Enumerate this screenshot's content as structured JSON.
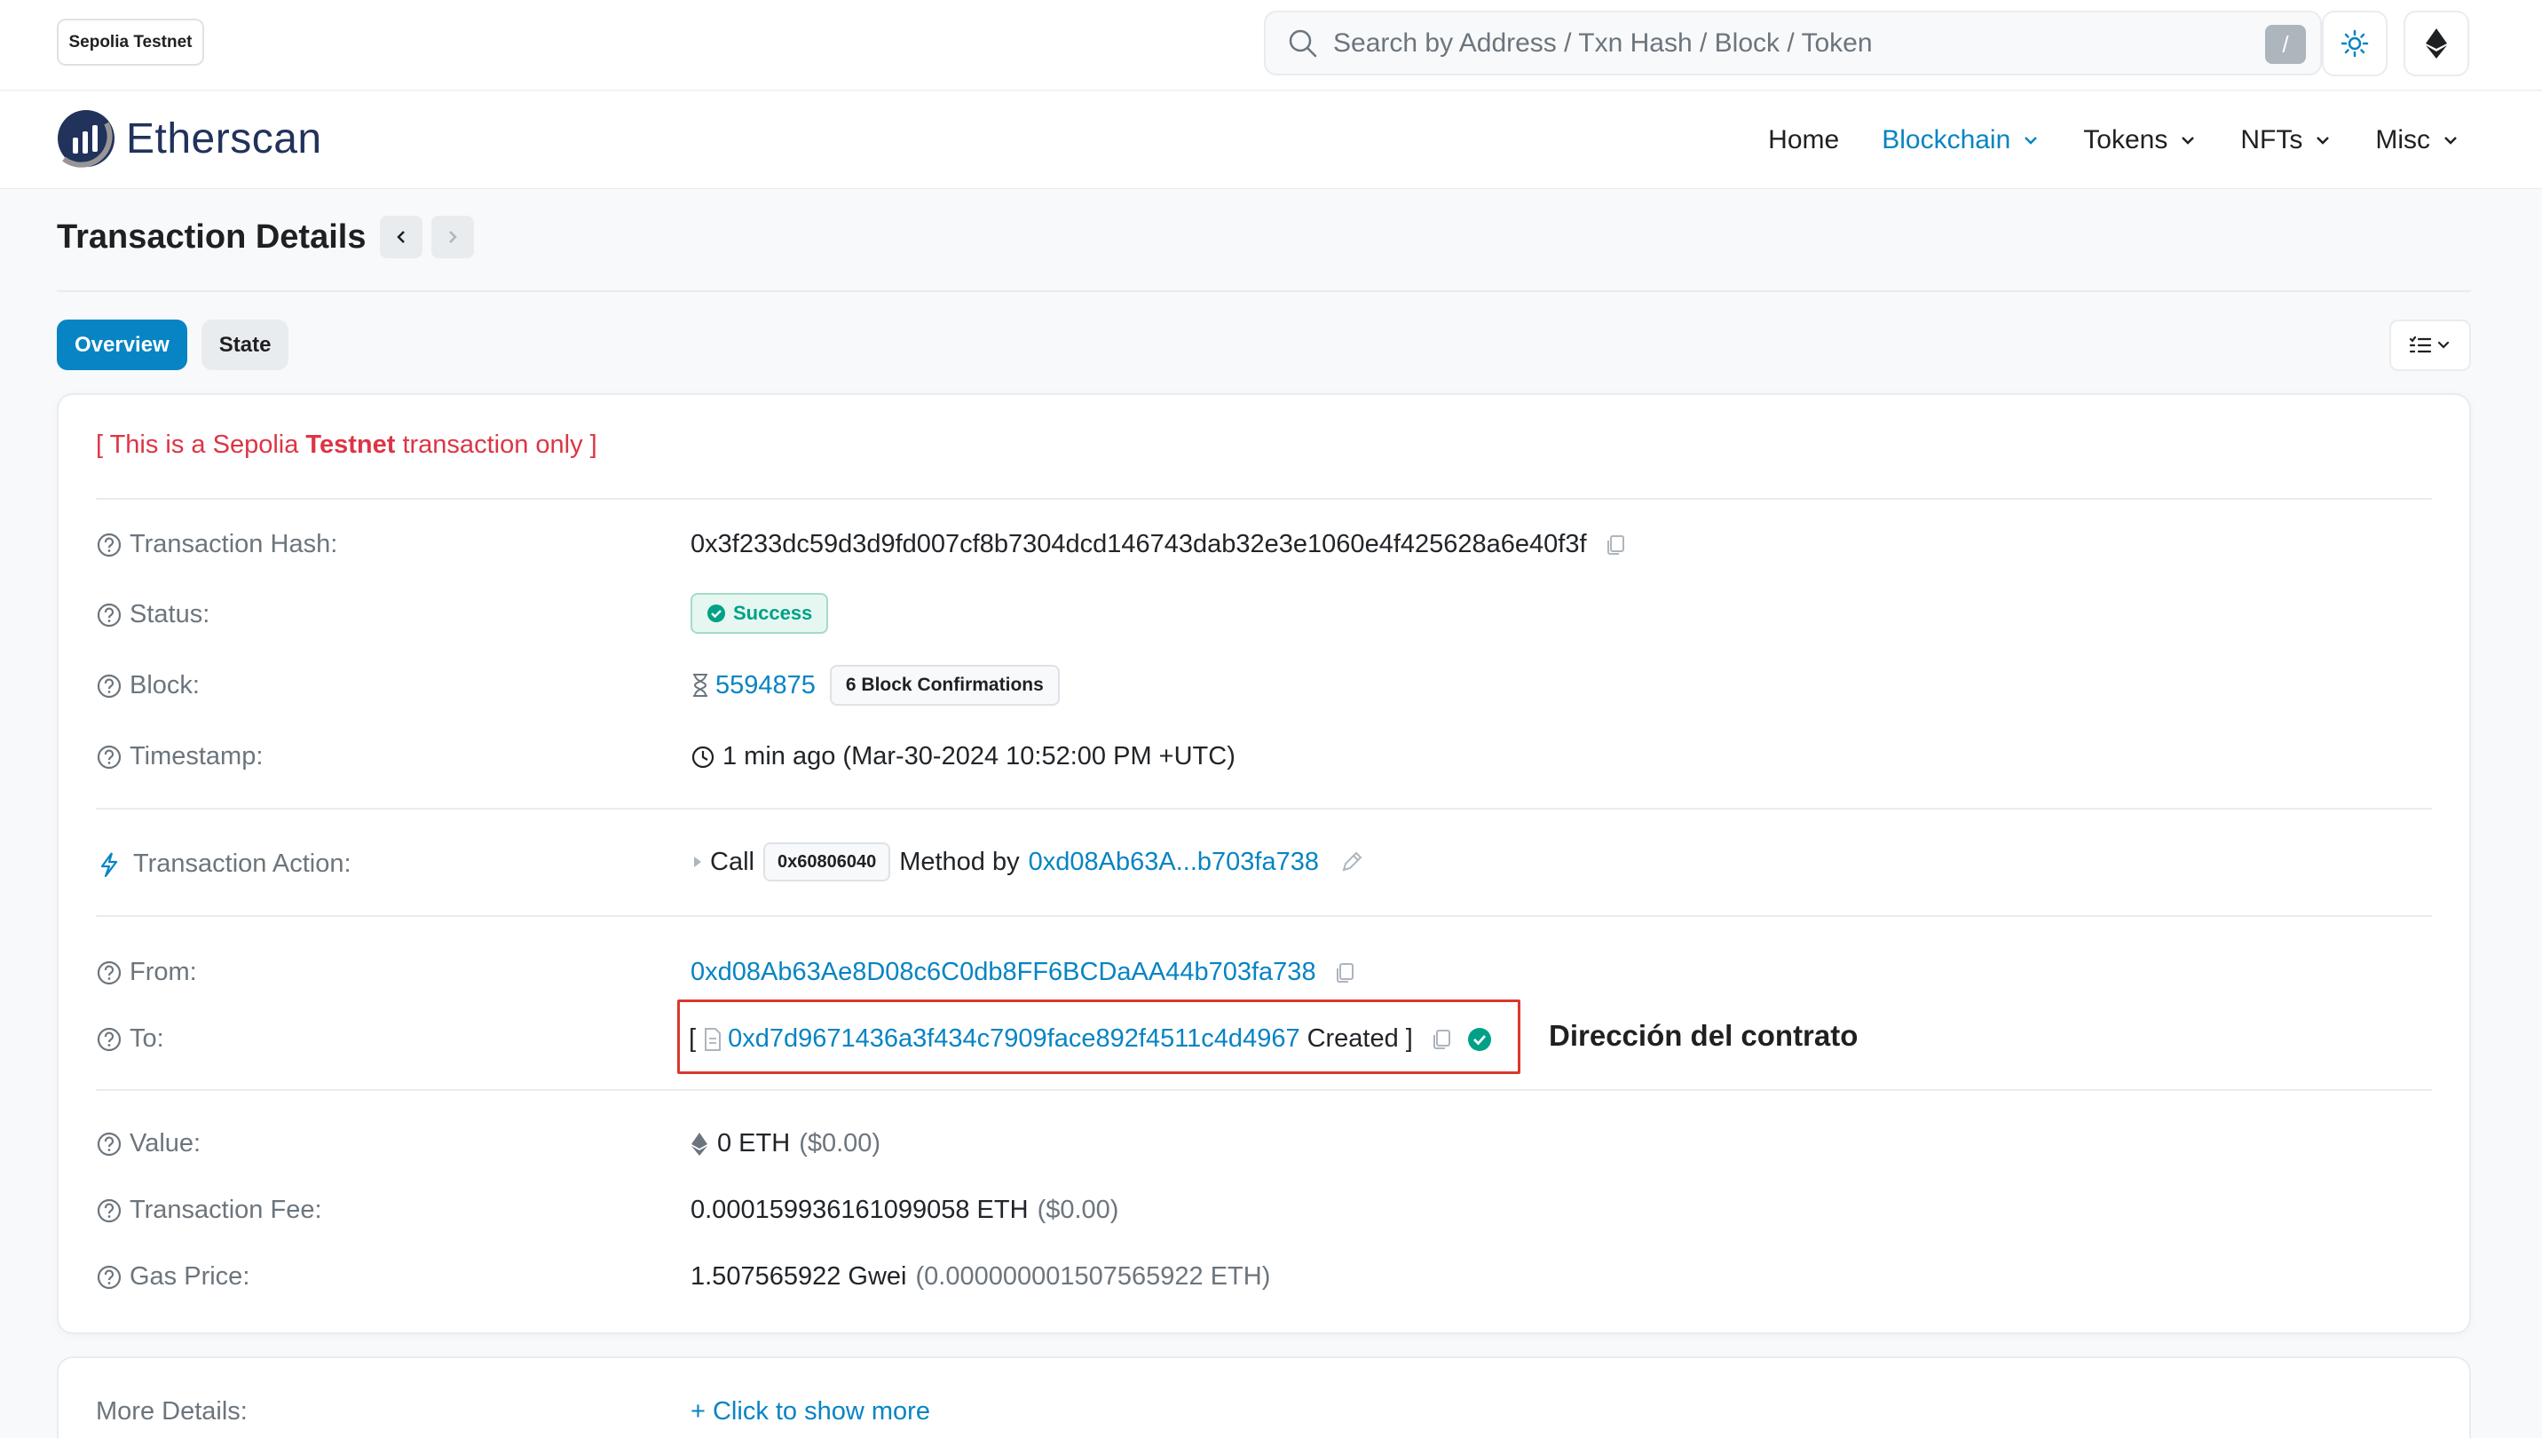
{
  "topbar": {
    "network_badge": "Sepolia Testnet",
    "search_placeholder": "Search by Address / Txn Hash / Block / Token",
    "search_shortcut": "/"
  },
  "navbar": {
    "logo_text": "Etherscan",
    "items": [
      {
        "label": "Home",
        "active": false,
        "dropdown": false
      },
      {
        "label": "Blockchain",
        "active": true,
        "dropdown": true
      },
      {
        "label": "Tokens",
        "active": false,
        "dropdown": true
      },
      {
        "label": "NFTs",
        "active": false,
        "dropdown": true
      },
      {
        "label": "Misc",
        "active": false,
        "dropdown": true
      }
    ]
  },
  "page": {
    "title": "Transaction Details",
    "tabs": [
      {
        "label": "Overview",
        "active": true
      },
      {
        "label": "State",
        "active": false
      }
    ]
  },
  "notice": {
    "prefix": "[ This is a Sepolia ",
    "bold": "Testnet",
    "suffix": " transaction only ]"
  },
  "details": {
    "tx_hash": {
      "label": "Transaction Hash:",
      "value": "0x3f233dc59d3d9fd007cf8b7304dcd146743dab32e3e1060e4f425628a6e40f3f"
    },
    "status": {
      "label": "Status:",
      "value": "Success"
    },
    "block": {
      "label": "Block:",
      "value": "5594875",
      "confirmations": "6 Block Confirmations"
    },
    "timestamp": {
      "label": "Timestamp:",
      "value": "1 min ago (Mar-30-2024 10:52:00 PM +UTC)"
    },
    "action": {
      "label": "Transaction Action:",
      "call": "Call",
      "method_id": "0x60806040",
      "method_by": "Method by",
      "address": "0xd08Ab63A...b703fa738"
    },
    "from": {
      "label": "From:",
      "value": "0xd08Ab63Ae8D08c6C0db8FF6BCDaAA44b703fa738"
    },
    "to": {
      "label": "To:",
      "open": "[",
      "address": "0xd7d9671436a3f434c7909face892f4511c4d4967",
      "created": "Created ]"
    },
    "value": {
      "label": "Value:",
      "amount": "0 ETH",
      "usd": "($0.00)"
    },
    "fee": {
      "label": "Transaction Fee:",
      "amount": "0.000159936161099058 ETH",
      "usd": "($0.00)"
    },
    "gas_price": {
      "label": "Gas Price:",
      "amount": "1.507565922 Gwei",
      "eth": "(0.000000001507565922 ETH)"
    }
  },
  "annotation": "Dirección del contrato",
  "more_details": {
    "label": "More Details:",
    "action": "+ Click to show more"
  },
  "colors": {
    "accent": "#0784c3",
    "success": "#00a186",
    "danger": "#dc3545",
    "annotation_box": "#d9382f"
  }
}
